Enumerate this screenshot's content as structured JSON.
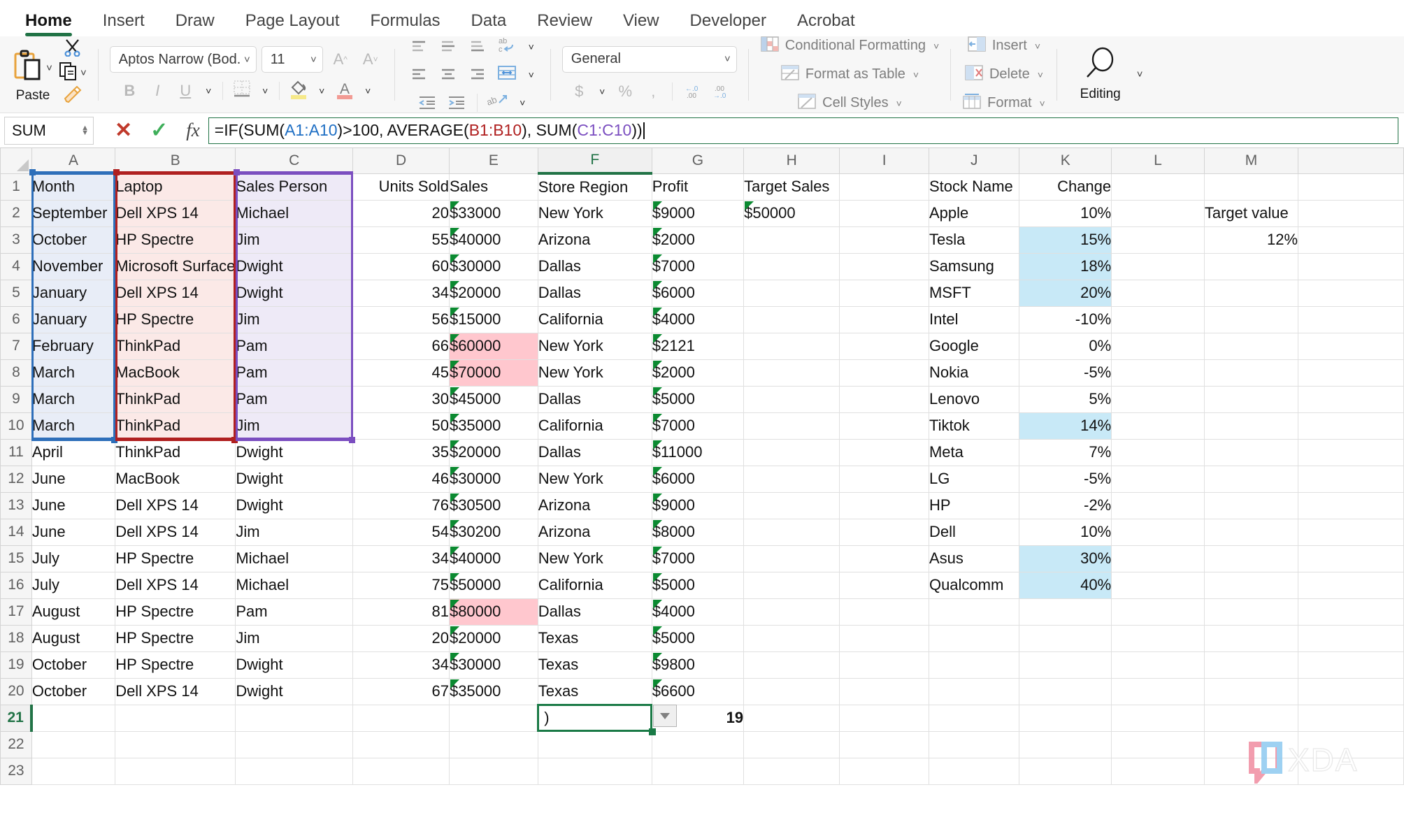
{
  "app": "Microsoft Excel",
  "ribbon": {
    "tabs": [
      {
        "label": "Home",
        "active": true
      },
      {
        "label": "Insert",
        "active": false
      },
      {
        "label": "Draw",
        "active": false
      },
      {
        "label": "Page Layout",
        "active": false
      },
      {
        "label": "Formulas",
        "active": false
      },
      {
        "label": "Data",
        "active": false
      },
      {
        "label": "Review",
        "active": false
      },
      {
        "label": "View",
        "active": false
      },
      {
        "label": "Developer",
        "active": false
      },
      {
        "label": "Acrobat",
        "active": false
      }
    ],
    "clipboard": {
      "paste_label": "Paste"
    },
    "font": {
      "name_value": "Aptos Narrow (Bod...",
      "size_value": "11",
      "bold_label": "B",
      "italic_label": "I",
      "underline_label": "U",
      "grow_label": "A",
      "shrink_label": "A"
    },
    "number": {
      "format_value": "General"
    },
    "styles": {
      "conditional_formatting": "Conditional Formatting",
      "format_as_table": "Format as Table",
      "cell_styles": "Cell Styles"
    },
    "cells": {
      "insert": "Insert",
      "delete": "Delete",
      "format": "Format"
    },
    "editing": {
      "label": "Editing"
    }
  },
  "formula_bar": {
    "name_box": "SUM",
    "cancel_icon": "cancel-icon",
    "enter_icon": "confirm-icon",
    "fx_label": "fx",
    "formula_parts": [
      {
        "text": "=IF(SUM(",
        "color": "default"
      },
      {
        "text": "A1:A10",
        "color": "blue"
      },
      {
        "text": ")>100, AVERAGE(",
        "color": "default"
      },
      {
        "text": "B1:B10",
        "color": "red"
      },
      {
        "text": "), SUM(",
        "color": "default"
      },
      {
        "text": "C1:C10",
        "color": "purple"
      },
      {
        "text": "))",
        "color": "default"
      }
    ],
    "formula_text": "=IF(SUM(A1:A10)>100, AVERAGE(B1:B10), SUM(C1:C10))"
  },
  "sheet": {
    "columns": [
      "A",
      "B",
      "C",
      "D",
      "E",
      "F",
      "G",
      "H",
      "I",
      "J",
      "K",
      "L",
      "M"
    ],
    "selected_column": "F",
    "selected_row": 21,
    "active_cell_value": ")",
    "rows": [
      {
        "n": 1,
        "A": "Month",
        "B": "Laptop",
        "C": "Sales Person",
        "D": "Units Sold",
        "E": "Sales",
        "F": "Store Region",
        "G": "Profit",
        "H": "Target Sales",
        "I": "",
        "J": "Stock Name",
        "K": "Change",
        "L": "",
        "M": ""
      },
      {
        "n": 2,
        "A": "September",
        "B": "Dell XPS 14",
        "C": "Michael",
        "D": "20",
        "E": "$33000",
        "F": "New York",
        "G": "$9000",
        "H": "$50000",
        "I": "",
        "J": "Apple",
        "K": "10%",
        "L": "",
        "M": "Target value"
      },
      {
        "n": 3,
        "A": "October",
        "B": "HP Spectre",
        "C": "Jim",
        "D": "55",
        "E": "$40000",
        "F": "Arizona",
        "G": "$2000",
        "H": "",
        "I": "",
        "J": "Tesla",
        "K": "15%",
        "L": "",
        "M": "12%"
      },
      {
        "n": 4,
        "A": "November",
        "B": "Microsoft Surface",
        "C": "Dwight",
        "D": "60",
        "E": "$30000",
        "F": "Dallas",
        "G": "$7000",
        "H": "",
        "I": "",
        "J": "Samsung",
        "K": "18%",
        "L": "",
        "M": ""
      },
      {
        "n": 5,
        "A": "January",
        "B": "Dell XPS 14",
        "C": "Dwight",
        "D": "34",
        "E": "$20000",
        "F": "Dallas",
        "G": "$6000",
        "H": "",
        "I": "",
        "J": "MSFT",
        "K": "20%",
        "L": "",
        "M": ""
      },
      {
        "n": 6,
        "A": "January",
        "B": "HP Spectre",
        "C": "Jim",
        "D": "56",
        "E": "$15000",
        "F": "California",
        "G": "$4000",
        "H": "",
        "I": "",
        "J": "Intel",
        "K": "-10%",
        "L": "",
        "M": ""
      },
      {
        "n": 7,
        "A": "February",
        "B": "ThinkPad",
        "C": "Pam",
        "D": "66",
        "E": "$60000",
        "F": "New York",
        "G": "$2121",
        "H": "",
        "I": "",
        "J": "Google",
        "K": "0%",
        "L": "",
        "M": ""
      },
      {
        "n": 8,
        "A": "March",
        "B": "MacBook",
        "C": "Pam",
        "D": "45",
        "E": "$70000",
        "F": "New York",
        "G": "$2000",
        "H": "",
        "I": "",
        "J": "Nokia",
        "K": "-5%",
        "L": "",
        "M": ""
      },
      {
        "n": 9,
        "A": "March",
        "B": "ThinkPad",
        "C": "Pam",
        "D": "30",
        "E": "$45000",
        "F": "Dallas",
        "G": "$5000",
        "H": "",
        "I": "",
        "J": "Lenovo",
        "K": "5%",
        "L": "",
        "M": ""
      },
      {
        "n": 10,
        "A": "March",
        "B": "ThinkPad",
        "C": "Jim",
        "D": "50",
        "E": "$35000",
        "F": "California",
        "G": "$7000",
        "H": "",
        "I": "",
        "J": "Tiktok",
        "K": "14%",
        "L": "",
        "M": ""
      },
      {
        "n": 11,
        "A": "April",
        "B": "ThinkPad",
        "C": "Dwight",
        "D": "35",
        "E": "$20000",
        "F": "Dallas",
        "G": "$11000",
        "H": "",
        "I": "",
        "J": "Meta",
        "K": "7%",
        "L": "",
        "M": ""
      },
      {
        "n": 12,
        "A": "June",
        "B": "MacBook",
        "C": "Dwight",
        "D": "46",
        "E": "$30000",
        "F": "New York",
        "G": "$6000",
        "H": "",
        "I": "",
        "J": "LG",
        "K": "-5%",
        "L": "",
        "M": ""
      },
      {
        "n": 13,
        "A": "June",
        "B": "Dell XPS 14",
        "C": "Dwight",
        "D": "76",
        "E": "$30500",
        "F": "Arizona",
        "G": "$9000",
        "H": "",
        "I": "",
        "J": "HP",
        "K": "-2%",
        "L": "",
        "M": ""
      },
      {
        "n": 14,
        "A": "June",
        "B": "Dell XPS 14",
        "C": "Jim",
        "D": "54",
        "E": "$30200",
        "F": "Arizona",
        "G": "$8000",
        "H": "",
        "I": "",
        "J": "Dell",
        "K": "10%",
        "L": "",
        "M": ""
      },
      {
        "n": 15,
        "A": "July",
        "B": "HP Spectre",
        "C": "Michael",
        "D": "34",
        "E": "$40000",
        "F": "New York",
        "G": "$7000",
        "H": "",
        "I": "",
        "J": "Asus",
        "K": "30%",
        "L": "",
        "M": ""
      },
      {
        "n": 16,
        "A": "July",
        "B": "Dell XPS 14",
        "C": "Michael",
        "D": "75",
        "E": "$50000",
        "F": "California",
        "G": "$5000",
        "H": "",
        "I": "",
        "J": "Qualcomm",
        "K": "40%",
        "L": "",
        "M": ""
      },
      {
        "n": 17,
        "A": "August",
        "B": "HP Spectre",
        "C": "Pam",
        "D": "81",
        "E": "$80000",
        "F": "Dallas",
        "G": "$4000",
        "H": "",
        "I": "",
        "J": "",
        "K": "",
        "L": "",
        "M": ""
      },
      {
        "n": 18,
        "A": "August",
        "B": "HP Spectre",
        "C": "Jim",
        "D": "20",
        "E": "$20000",
        "F": "Texas",
        "G": "$5000",
        "H": "",
        "I": "",
        "J": "",
        "K": "",
        "L": "",
        "M": ""
      },
      {
        "n": 19,
        "A": "October",
        "B": "HP Spectre",
        "C": "Dwight",
        "D": "34",
        "E": "$30000",
        "F": "Texas",
        "G": "$9800",
        "H": "",
        "I": "",
        "J": "",
        "K": "",
        "L": "",
        "M": ""
      },
      {
        "n": 20,
        "A": "October",
        "B": "Dell XPS 14",
        "C": "Dwight",
        "D": "67",
        "E": "$35000",
        "F": "Texas",
        "G": "$6600",
        "H": "",
        "I": "",
        "J": "",
        "K": "",
        "L": "",
        "M": ""
      },
      {
        "n": 21,
        "A": "",
        "B": "",
        "C": "",
        "D": "",
        "E": "",
        "F": "",
        "G": "19",
        "H": "",
        "I": "",
        "J": "",
        "K": "",
        "L": "",
        "M": ""
      },
      {
        "n": 22,
        "A": "",
        "B": "",
        "C": "",
        "D": "",
        "E": "",
        "F": "",
        "G": "",
        "H": "",
        "I": "",
        "J": "",
        "K": "",
        "L": "",
        "M": ""
      },
      {
        "n": 23,
        "A": "",
        "B": "",
        "C": "",
        "D": "",
        "E": "",
        "F": "",
        "G": "",
        "H": "",
        "I": "",
        "J": "",
        "K": "",
        "L": "",
        "M": ""
      }
    ],
    "formatting": {
      "range_a_fill_rows": [
        1,
        2,
        3,
        4,
        5,
        6,
        7,
        8,
        9,
        10
      ],
      "range_b_fill_rows": [
        1,
        2,
        3,
        4,
        5,
        6,
        7,
        8,
        9,
        10
      ],
      "range_c_fill_rows": [
        1,
        2,
        3,
        4,
        5,
        6,
        7,
        8,
        9,
        10
      ],
      "pink_highlight_cells": [
        "E7",
        "E8",
        "E17"
      ],
      "cyan_highlight_cells": [
        "K3",
        "K4",
        "K5",
        "K10",
        "K15",
        "K16"
      ],
      "error_triangle_columns": [
        "E",
        "G",
        "H"
      ],
      "bold_cells": [
        "G21"
      ]
    },
    "colors": {
      "range_a_border": "#2e6fba",
      "range_b_border": "#b02020",
      "range_c_border": "#7b4ec0",
      "accent_green": "#217346",
      "pink_fill": "#ffc7ce",
      "pink_text": "#9c0006",
      "cyan_fill": "#c8e9f7"
    }
  },
  "watermark": {
    "text": "XDA"
  }
}
